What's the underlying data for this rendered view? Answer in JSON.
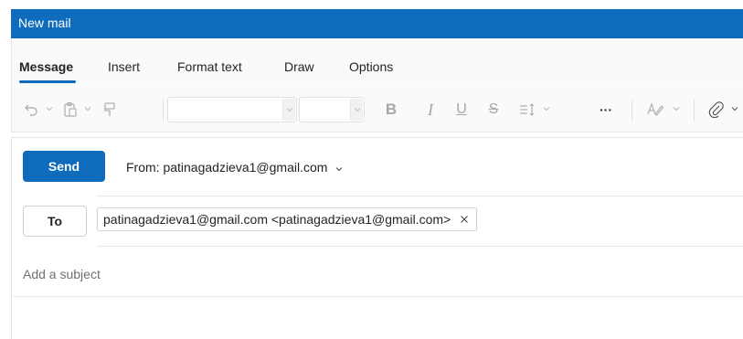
{
  "window": {
    "title": "New mail"
  },
  "tabs": [
    {
      "label": "Message",
      "active": true
    },
    {
      "label": "Insert",
      "active": false
    },
    {
      "label": "Format text",
      "active": false
    },
    {
      "label": "Draw",
      "active": false
    },
    {
      "label": "Options",
      "active": false
    }
  ],
  "toolbar": {
    "font_name": "",
    "font_size": "",
    "icons": [
      "undo-icon",
      "paste-icon",
      "format-painter-icon",
      "bold-icon",
      "italic-icon",
      "underline-icon",
      "strikethrough-icon",
      "line-spacing-icon",
      "more-options-icon",
      "editor-icon",
      "attach-icon"
    ],
    "bold_glyph": "B",
    "italic_glyph": "I",
    "underline_glyph": "U",
    "strike_glyph": "S",
    "more_glyph": "···"
  },
  "compose": {
    "send_label": "Send",
    "from_label": "From: patinagadzieva1@gmail.com",
    "to_label": "To",
    "recipient": "patinagadzieva1@gmail.com <patinagadzieva1@gmail.com>",
    "subject_placeholder": "Add a subject"
  },
  "colors": {
    "accent": "#0f6cbd",
    "toolbar_bg": "#fafafa",
    "disabled_icon": "#a7a7a7"
  }
}
